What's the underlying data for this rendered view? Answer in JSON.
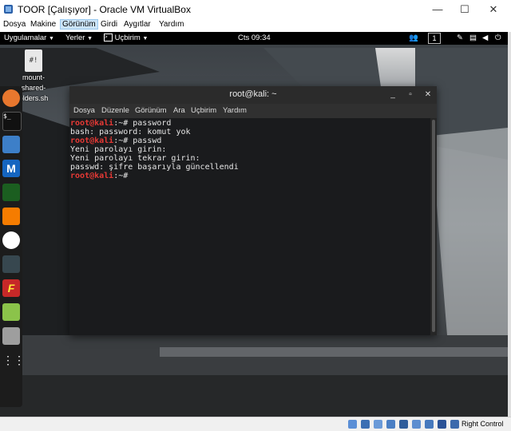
{
  "host": {
    "title": "TOOR [Çalışıyor] - Oracle VM VirtualBox",
    "window_buttons": {
      "minimize": "—",
      "maximize": "☐",
      "close": "✕"
    },
    "menu": [
      "Dosya",
      "Makine",
      "Görünüm",
      "Girdi",
      "Aygıtlar",
      "Yardım"
    ],
    "active_menu": "Görünüm",
    "status_right": "Right Control"
  },
  "guest_panel": {
    "applications": "Uygulamalar",
    "places": "Yerler",
    "terminal": "Uçbirim",
    "clock": "Cts 09:34",
    "workspace": "1"
  },
  "desktop_icon": {
    "glyph": "#!",
    "label_lines": [
      "mount-",
      "shared-",
      "olders.sh"
    ]
  },
  "terminal": {
    "title": "root@kali: ~",
    "menu": [
      "Dosya",
      "Düzenle",
      "Görünüm",
      "Ara",
      "Uçbirim",
      "Yardım"
    ],
    "lines": [
      {
        "prompt": "root@kali",
        "text": ":~# password"
      },
      {
        "prompt": "",
        "text": "bash: password: komut yok"
      },
      {
        "prompt": "root@kali",
        "text": ":~# passwd"
      },
      {
        "prompt": "",
        "text": "Yeni parolayı girin:"
      },
      {
        "prompt": "",
        "text": "Yeni parolayı tekrar girin:"
      },
      {
        "prompt": "",
        "text": "passwd: şifre başarıyla güncellendi"
      },
      {
        "prompt": "root@kali",
        "text": ":~# "
      }
    ]
  },
  "colors": {
    "prompt": "#e53935",
    "terminal_bg": "#1a1b1d",
    "panel_bg": "#000000"
  },
  "dock_icons": [
    "firefox-icon",
    "terminal-icon",
    "files-icon",
    "metasploit-icon",
    "armitage-icon",
    "burpsuite-icon",
    "maltego-icon",
    "beef-icon",
    "faraday-icon",
    "leafpad-icon",
    "screenshot-icon",
    "show-apps-icon"
  ]
}
